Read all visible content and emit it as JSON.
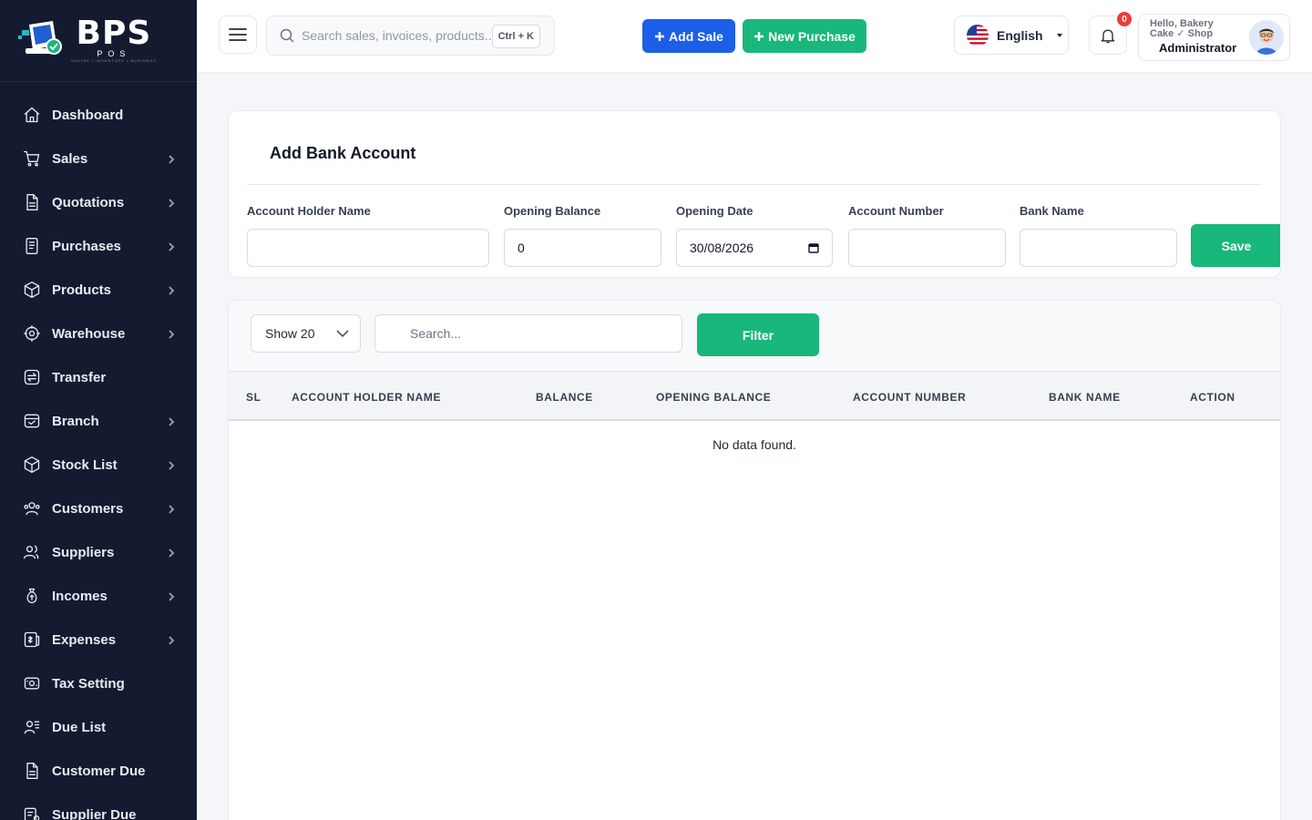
{
  "brand": {
    "name": "BPS",
    "sub": "POS",
    "tagline": "ONLINE | INVENTORY | BUSINESS"
  },
  "sidebar": {
    "items": [
      {
        "label": "Dashboard",
        "icon": "home-icon",
        "has_submenu": false
      },
      {
        "label": "Sales",
        "icon": "cart-icon",
        "has_submenu": true
      },
      {
        "label": "Quotations",
        "icon": "document-icon",
        "has_submenu": true
      },
      {
        "label": "Purchases",
        "icon": "receipt-icon",
        "has_submenu": true
      },
      {
        "label": "Products",
        "icon": "box-icon",
        "has_submenu": true
      },
      {
        "label": "Warehouse",
        "icon": "warehouse-icon",
        "has_submenu": true
      },
      {
        "label": "Transfer",
        "icon": "transfer-icon",
        "has_submenu": false
      },
      {
        "label": "Branch",
        "icon": "branch-icon",
        "has_submenu": true
      },
      {
        "label": "Stock List",
        "icon": "stock-icon",
        "has_submenu": true
      },
      {
        "label": "Customers",
        "icon": "customers-icon",
        "has_submenu": true
      },
      {
        "label": "Suppliers",
        "icon": "suppliers-icon",
        "has_submenu": true
      },
      {
        "label": "Incomes",
        "icon": "money-bag-icon",
        "has_submenu": true
      },
      {
        "label": "Expenses",
        "icon": "expense-icon",
        "has_submenu": true
      },
      {
        "label": "Tax Setting",
        "icon": "tax-icon",
        "has_submenu": false
      },
      {
        "label": "Due List",
        "icon": "due-list-icon",
        "has_submenu": false
      },
      {
        "label": "Customer Due",
        "icon": "customer-due-icon",
        "has_submenu": false
      },
      {
        "label": "Supplier Due",
        "icon": "supplier-due-icon",
        "has_submenu": false
      }
    ]
  },
  "topbar": {
    "search_placeholder": "Search sales, invoices, products...",
    "shortcut": "Ctrl + K",
    "add_sale_label": "Add Sale",
    "new_purchase_label": "New Purchase",
    "language": "English",
    "notification_count": "0",
    "greeting": "Hello, Bakery Cake ✓ Shop",
    "role": "Administrator"
  },
  "form": {
    "title": "Add Bank Account",
    "fields": [
      {
        "label": "Account Holder Name",
        "value": ""
      },
      {
        "label": "Opening Balance",
        "value": "0"
      },
      {
        "label": "Opening Date",
        "value": "30/08/2026"
      },
      {
        "label": "Account Number",
        "value": ""
      },
      {
        "label": "Bank Name",
        "value": ""
      }
    ],
    "save_label": "Save"
  },
  "table": {
    "show_label": "Show 20",
    "search_placeholder": "Search...",
    "filter_label": "Filter",
    "columns": [
      "SL",
      "ACCOUNT HOLDER NAME",
      "BALANCE",
      "OPENING BALANCE",
      "ACCOUNT NUMBER",
      "BANK NAME",
      "ACTION"
    ],
    "empty_message": "No data found."
  },
  "colors": {
    "sidebar_bg": "#141b30",
    "primary_blue": "#1b5fe9",
    "primary_green": "#18b77b",
    "badge_red": "#ef3b3b"
  }
}
